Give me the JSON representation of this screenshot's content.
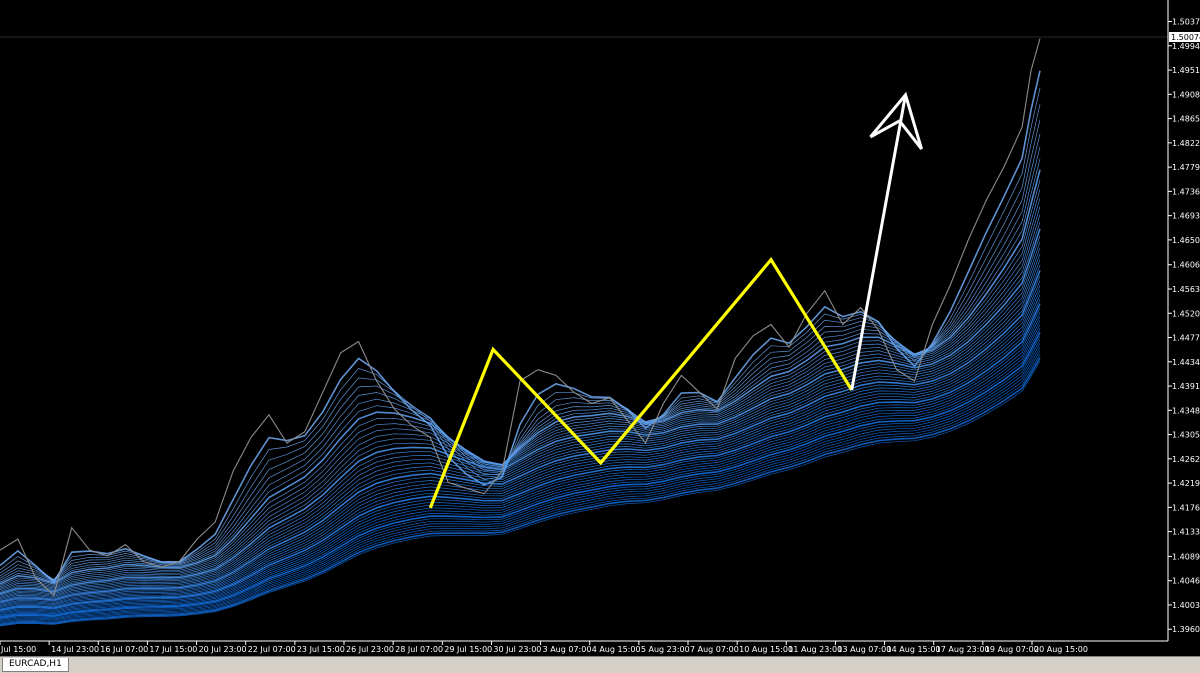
{
  "chart_data": {
    "type": "line",
    "symbol": "EURCAD,H1",
    "current_price_label": "1.50074",
    "ylim": [
      1.3948,
      1.5061
    ],
    "y_ticks": [
      "1.50370",
      "1.49940",
      "1.49510",
      "1.49080",
      "1.48650",
      "1.48220",
      "1.47790",
      "1.47360",
      "1.46930",
      "1.46500",
      "1.46060",
      "1.45630",
      "1.45200",
      "1.44770",
      "1.44340",
      "1.43910",
      "1.43480",
      "1.43050",
      "1.42620",
      "1.42190",
      "1.41760",
      "1.41330",
      "1.40890",
      "1.40460",
      "1.40030",
      "1.39600"
    ],
    "x_ticks": [
      "Jul 15:00",
      "14 Jul 23:00",
      "16 Jul 07:00",
      "17 Jul 15:00",
      "20 Jul 23:00",
      "22 Jul 07:00",
      "23 Jul 15:00",
      "26 Jul 23:00",
      "28 Jul 07:00",
      "29 Jul 15:00",
      "30 Jul 23:00",
      "3 Aug 07:00",
      "4 Aug 15:00",
      "5 Aug 23:00",
      "7 Aug 07:00",
      "10 Aug 15:00",
      "11 Aug 23:00",
      "13 Aug 07:00",
      "14 Aug 15:00",
      "17 Aug 23:00",
      "19 Aug 07:00",
      "20 Aug 15:00"
    ],
    "series": [
      {
        "color": "#8c8c8c",
        "points": [
          [
            0,
            1.41
          ],
          [
            2,
            1.412
          ],
          [
            4,
            1.405
          ],
          [
            6,
            1.402
          ],
          [
            8,
            1.414
          ],
          [
            10,
            1.41
          ],
          [
            12,
            1.409
          ],
          [
            14,
            1.411
          ],
          [
            16,
            1.408
          ],
          [
            18,
            1.407
          ],
          [
            20,
            1.408
          ],
          [
            22,
            1.412
          ],
          [
            24,
            1.415
          ],
          [
            26,
            1.424
          ],
          [
            28,
            1.43
          ],
          [
            30,
            1.434
          ],
          [
            32,
            1.429
          ],
          [
            34,
            1.431
          ],
          [
            36,
            1.438
          ],
          [
            38,
            1.445
          ],
          [
            40,
            1.447
          ],
          [
            42,
            1.44
          ],
          [
            44,
            1.435
          ],
          [
            46,
            1.432
          ],
          [
            48,
            1.43
          ],
          [
            50,
            1.422
          ],
          [
            52,
            1.421
          ],
          [
            54,
            1.42
          ],
          [
            56,
            1.424
          ],
          [
            58,
            1.44
          ],
          [
            60,
            1.442
          ],
          [
            62,
            1.441
          ],
          [
            64,
            1.438
          ],
          [
            66,
            1.436
          ],
          [
            68,
            1.437
          ],
          [
            70,
            1.433
          ],
          [
            72,
            1.429
          ],
          [
            74,
            1.436
          ],
          [
            76,
            1.441
          ],
          [
            78,
            1.438
          ],
          [
            80,
            1.435
          ],
          [
            82,
            1.444
          ],
          [
            84,
            1.448
          ],
          [
            86,
            1.45
          ],
          [
            88,
            1.446
          ],
          [
            90,
            1.452
          ],
          [
            92,
            1.456
          ],
          [
            94,
            1.45
          ],
          [
            96,
            1.453
          ],
          [
            98,
            1.449
          ],
          [
            100,
            1.442
          ],
          [
            102,
            1.44
          ],
          [
            104,
            1.45
          ],
          [
            106,
            1.457
          ],
          [
            108,
            1.465
          ],
          [
            110,
            1.472
          ],
          [
            112,
            1.478
          ],
          [
            114,
            1.485
          ],
          [
            115,
            1.495
          ],
          [
            116,
            1.5007
          ]
        ]
      },
      {
        "color": "#ffff00",
        "points": [
          [
            48,
            1.4175
          ],
          [
            55,
            1.4456
          ],
          [
            67,
            1.4255
          ],
          [
            86,
            1.4615
          ],
          [
            95,
            1.4384
          ]
        ]
      },
      {
        "color": "#ffffff",
        "points": [
          [
            95,
            1.4384
          ],
          [
            101,
            1.4907
          ]
        ]
      }
    ]
  }
}
